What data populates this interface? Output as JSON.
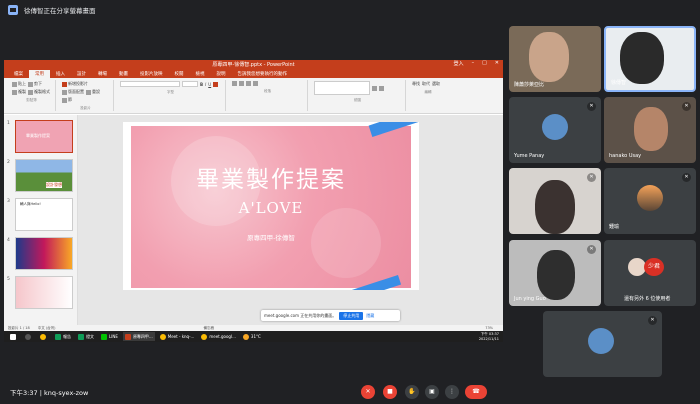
{
  "meet": {
    "banner_text": "徐傳智正在分享螢幕畫面",
    "time": "下午3:37",
    "separator": "|",
    "meeting_code": "knq-syex-zow",
    "others_count_text": "還有另外 6 位使用者"
  },
  "powerpoint": {
    "window_title": "原專四甲-徐傳智.pptx - PowerPoint",
    "login_label": "登入",
    "tabs": [
      "檔案",
      "常用",
      "插入",
      "設計",
      "轉場",
      "動畫",
      "投影片放映",
      "校閱",
      "檢視",
      "說明",
      "告訴我您想要執行的動作"
    ],
    "active_tab_index": 1,
    "ribbon": {
      "clipboard": [
        "貼上",
        "剪下",
        "複製",
        "複製格式"
      ],
      "clipboard_label": "剪貼簿",
      "slides": [
        "新增投影片",
        "版面配置",
        "重設",
        "節"
      ],
      "slides_label": "投影片",
      "font_label": "字型",
      "paragraph_label": "段落",
      "drawing_label": "繪圖",
      "editing": [
        "尋找",
        "取代",
        "選取"
      ],
      "editing_label": "編輯"
    },
    "slide_numbers": [
      "1",
      "2",
      "3",
      "4",
      "5"
    ],
    "thumb_texts": [
      "畢業製作提案",
      "設計發想",
      "輔人與Hello!",
      "",
      ""
    ],
    "slide": {
      "title": "畢業製作提案",
      "subtitle": "A'LOVE",
      "author": "原專四甲-徐傳智"
    },
    "status": {
      "slide_info": "投影片 1 / 18",
      "language": "中文 (台灣)",
      "notes": "備忘稿",
      "zoom": "73%"
    },
    "share_bar": {
      "text": "meet.google.com 正在共用你的畫面。",
      "stop": "停止共用",
      "hide": "隱藏"
    },
    "taskbar": {
      "apps": [
        "報告",
        "燈文",
        "LINE",
        "原專四甲...",
        "Meet - knq-...",
        "meet.googl..."
      ],
      "weather": "31°C",
      "time": "下午 03:37",
      "date": "2022/11/11"
    }
  },
  "participants": [
    {
      "name": "陳蕭莎萊亞比",
      "muted": false
    },
    {
      "name": "徐傳智",
      "muted": false
    },
    {
      "name": "Yume Panay",
      "muted": true
    },
    {
      "name": "hanako Usay",
      "muted": true
    },
    {
      "name": "",
      "muted": true
    },
    {
      "name": "鍾瑜",
      "muted": true
    },
    {
      "name": "Jun ying Guo",
      "muted": true
    },
    {
      "name": "少君",
      "muted": false
    },
    {
      "name": "",
      "muted": true
    }
  ],
  "colors": {
    "meet_bg": "#202124",
    "tile_bg": "#3c4043",
    "ppt_red": "#c43e1c",
    "hangup_red": "#ea4335",
    "meet_blue": "#8ab4f8"
  },
  "icons": [
    "present-icon",
    "mic-off-icon",
    "mic-icon",
    "camera-icon",
    "raise-hand-icon",
    "present-now-icon",
    "more-icon",
    "hangup-icon"
  ]
}
